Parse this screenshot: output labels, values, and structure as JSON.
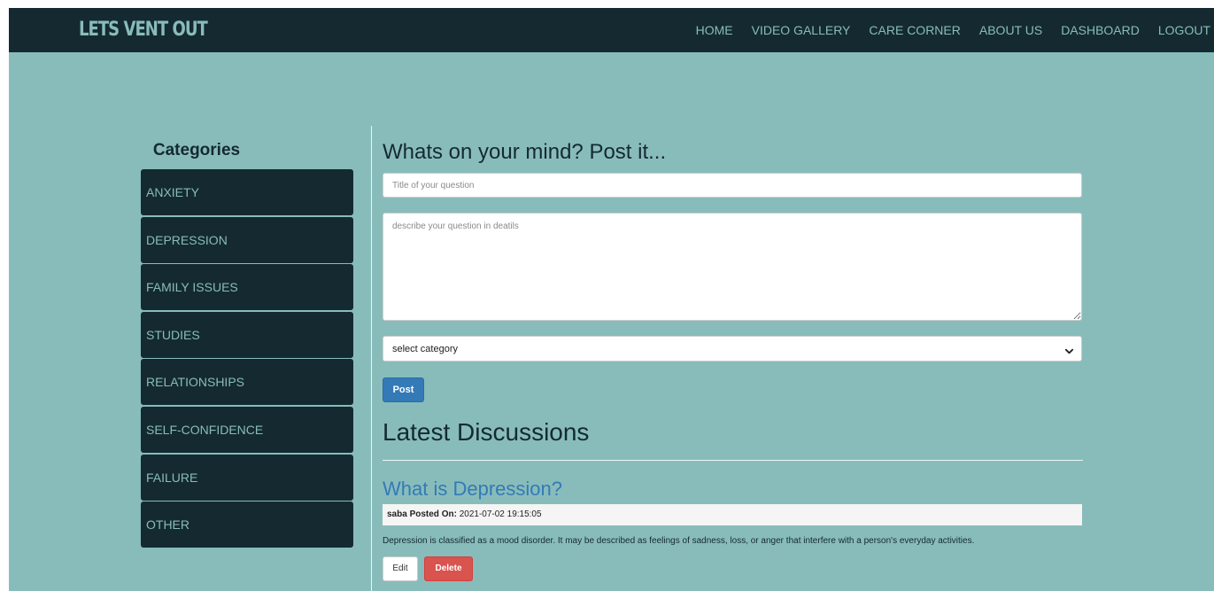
{
  "navbar": {
    "brand": "LETS VENT OUT",
    "links": [
      "HOME",
      "VIDEO GALLERY",
      "CARE CORNER",
      "ABOUT US",
      "DASHBOARD",
      "LOGOUT"
    ]
  },
  "sidebar": {
    "title": "Categories",
    "items": [
      "ANXIETY",
      "DEPRESSION",
      "FAMILY ISSUES",
      "STUDIES",
      "RELATIONSHIPS",
      "SELF-CONFIDENCE",
      "FAILURE",
      "OTHER"
    ]
  },
  "post_form": {
    "heading": "Whats on your mind? Post it...",
    "title_placeholder": "Title of your question",
    "description_placeholder": "describe your question in deatils",
    "category_selected": "select category",
    "submit_label": "Post"
  },
  "discussions": {
    "heading": "Latest Discussions",
    "items": [
      {
        "title": "What is Depression?",
        "author": "saba",
        "posted_on_label": "Posted On:",
        "posted_on": "2021-07-02 19:15:05",
        "body": "Depression is classified as a mood disorder. It may be described as feelings of sadness, loss, or anger that interfere with a person's everyday activities.",
        "edit_label": "Edit",
        "delete_label": "Delete"
      }
    ]
  },
  "colors": {
    "navbar_bg": "#142a30",
    "page_bg": "#88bcba",
    "link_blue": "#337ab7",
    "delete_red": "#d9534f"
  },
  "icons": {
    "select_arrow": "chevron-down-icon"
  }
}
